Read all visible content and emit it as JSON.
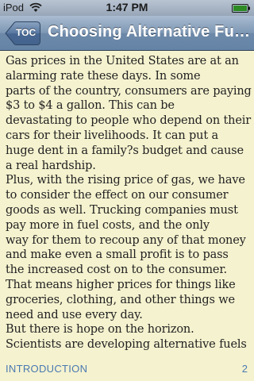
{
  "status_bar": {
    "carrier": "iPod",
    "time": "1:47 PM"
  },
  "nav_bar": {
    "back_label": "TOC",
    "title": "Choosing Alternative Fu…"
  },
  "content": {
    "lines": [
      "Gas prices in the United States are at an",
      "alarming rate these days. In some",
      "parts of the country, consumers are paying",
      "$3 to $4 a gallon. This can be",
      "devastating to people who depend on their",
      "cars for their livelihoods. It can put a",
      "huge dent in a family?s budget and cause",
      "a real hardship.",
      "Plus, with the rising price of gas, we have",
      "to consider the effect on our consumer",
      "goods as well. Trucking companies must",
      "pay more in fuel costs, and the only",
      "way for them to recoup any of that money",
      "and make even a small profit is to pass",
      "the increased cost on to the consumer.",
      "That means higher prices for things like",
      "groceries, clothing, and other things we",
      "need and use every day.",
      "But there is hope on the horizon.",
      "Scientists are developing alternative fuels"
    ]
  },
  "footer": {
    "section": "INTRODUCTION",
    "page": "2"
  }
}
